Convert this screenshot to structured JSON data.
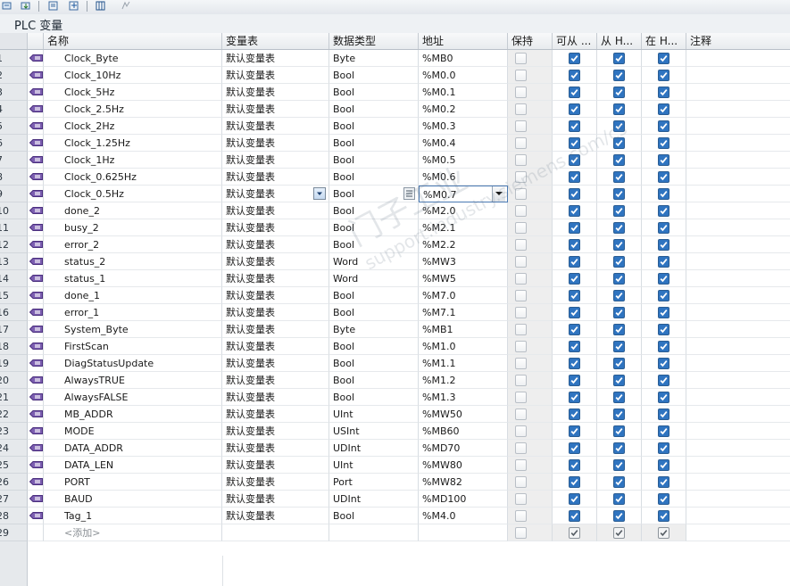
{
  "panel": {
    "title": "PLC 变量"
  },
  "toolbar": {
    "buttons": [
      "add-tag-icon",
      "import-icon",
      "export-icon",
      "tags-view-icon",
      "monitor-icon"
    ]
  },
  "columns": {
    "name": "名称",
    "tag_table": "变量表",
    "data_type": "数据类型",
    "address": "地址",
    "retain": "保持",
    "accessible": "可从 ...",
    "writable": "从 H...",
    "visible": "在 H...",
    "comment": "注释"
  },
  "rows": [
    {
      "num": "1",
      "name": "Clock_Byte",
      "table": "默认变量表",
      "type": "Byte",
      "address": "%MB0"
    },
    {
      "num": "2",
      "name": "Clock_10Hz",
      "table": "默认变量表",
      "type": "Bool",
      "address": "%M0.0"
    },
    {
      "num": "3",
      "name": "Clock_5Hz",
      "table": "默认变量表",
      "type": "Bool",
      "address": "%M0.1"
    },
    {
      "num": "4",
      "name": "Clock_2.5Hz",
      "table": "默认变量表",
      "type": "Bool",
      "address": "%M0.2"
    },
    {
      "num": "5",
      "name": "Clock_2Hz",
      "table": "默认变量表",
      "type": "Bool",
      "address": "%M0.3"
    },
    {
      "num": "6",
      "name": "Clock_1.25Hz",
      "table": "默认变量表",
      "type": "Bool",
      "address": "%M0.4"
    },
    {
      "num": "7",
      "name": "Clock_1Hz",
      "table": "默认变量表",
      "type": "Bool",
      "address": "%M0.5"
    },
    {
      "num": "8",
      "name": "Clock_0.625Hz",
      "table": "默认变量表",
      "type": "Bool",
      "address": "%M0.6"
    },
    {
      "num": "9",
      "name": "Clock_0.5Hz",
      "table": "默认变量表",
      "type": "Bool",
      "address": "%M0.7"
    },
    {
      "num": "10",
      "name": "done_2",
      "table": "默认变量表",
      "type": "Bool",
      "address": "%M2.0"
    },
    {
      "num": "11",
      "name": "busy_2",
      "table": "默认变量表",
      "type": "Bool",
      "address": "%M2.1"
    },
    {
      "num": "12",
      "name": "error_2",
      "table": "默认变量表",
      "type": "Bool",
      "address": "%M2.2"
    },
    {
      "num": "13",
      "name": "status_2",
      "table": "默认变量表",
      "type": "Word",
      "address": "%MW3"
    },
    {
      "num": "14",
      "name": "status_1",
      "table": "默认变量表",
      "type": "Word",
      "address": "%MW5"
    },
    {
      "num": "15",
      "name": "done_1",
      "table": "默认变量表",
      "type": "Bool",
      "address": "%M7.0"
    },
    {
      "num": "16",
      "name": "error_1",
      "table": "默认变量表",
      "type": "Bool",
      "address": "%M7.1"
    },
    {
      "num": "17",
      "name": "System_Byte",
      "table": "默认变量表",
      "type": "Byte",
      "address": "%MB1"
    },
    {
      "num": "18",
      "name": "FirstScan",
      "table": "默认变量表",
      "type": "Bool",
      "address": "%M1.0"
    },
    {
      "num": "19",
      "name": "DiagStatusUpdate",
      "table": "默认变量表",
      "type": "Bool",
      "address": "%M1.1"
    },
    {
      "num": "20",
      "name": "AlwaysTRUE",
      "table": "默认变量表",
      "type": "Bool",
      "address": "%M1.2"
    },
    {
      "num": "21",
      "name": "AlwaysFALSE",
      "table": "默认变量表",
      "type": "Bool",
      "address": "%M1.3"
    },
    {
      "num": "22",
      "name": "MB_ADDR",
      "table": "默认变量表",
      "type": "UInt",
      "address": "%MW50"
    },
    {
      "num": "23",
      "name": "MODE",
      "table": "默认变量表",
      "type": "USInt",
      "address": "%MB60"
    },
    {
      "num": "24",
      "name": "DATA_ADDR",
      "table": "默认变量表",
      "type": "UDInt",
      "address": "%MD70"
    },
    {
      "num": "25",
      "name": "DATA_LEN",
      "table": "默认变量表",
      "type": "UInt",
      "address": "%MW80"
    },
    {
      "num": "26",
      "name": "PORT",
      "table": "默认变量表",
      "type": "Port",
      "address": "%MW82"
    },
    {
      "num": "27",
      "name": "BAUD",
      "table": "默认变量表",
      "type": "UDInt",
      "address": "%MD100"
    },
    {
      "num": "28",
      "name": "Tag_1",
      "table": "默认变量表",
      "type": "Bool",
      "address": "%M4.0"
    }
  ],
  "add_row": {
    "num": "29",
    "placeholder": "<添加>"
  },
  "selected_row_index": 8,
  "watermark": [
    "门子工业",
    "support.industry.siemens.com/cs"
  ],
  "colors": {
    "checkbox_checked": "#2f74c0",
    "header_bg": "#e8ebee",
    "rownum_bg": "#e6e9ec"
  }
}
